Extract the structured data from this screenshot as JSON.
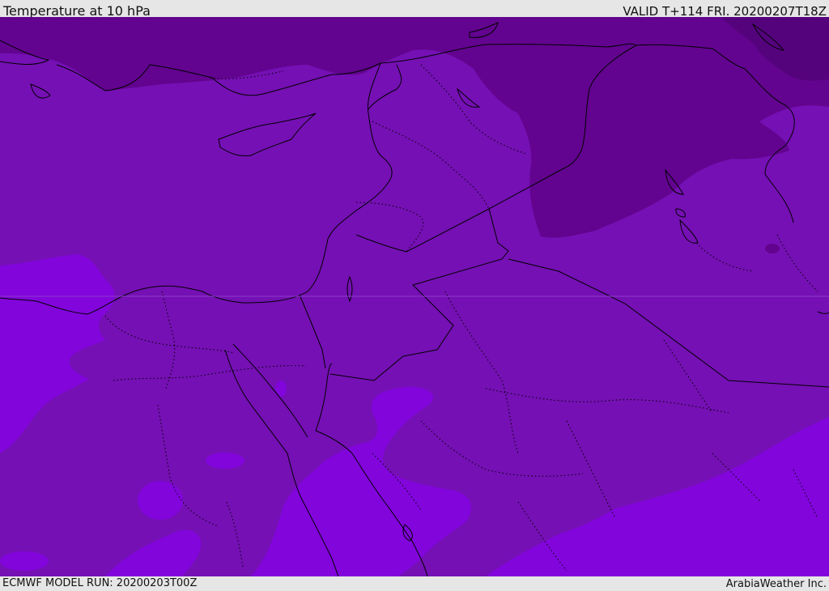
{
  "header": {
    "title": "Temperature at 10 hPa",
    "valid": "VALID T+114 FRI. 20200207T18Z"
  },
  "footer": {
    "model_run": "ECMWF MODEL RUN: 20200203T00Z",
    "credit": "ArabiaWeather Inc."
  },
  "colors": {
    "background_band": "#7510b4",
    "cold_band": "#62048f",
    "coldest_band": "#55037d",
    "warm_band": "#8205dc",
    "borders": "#000000"
  }
}
